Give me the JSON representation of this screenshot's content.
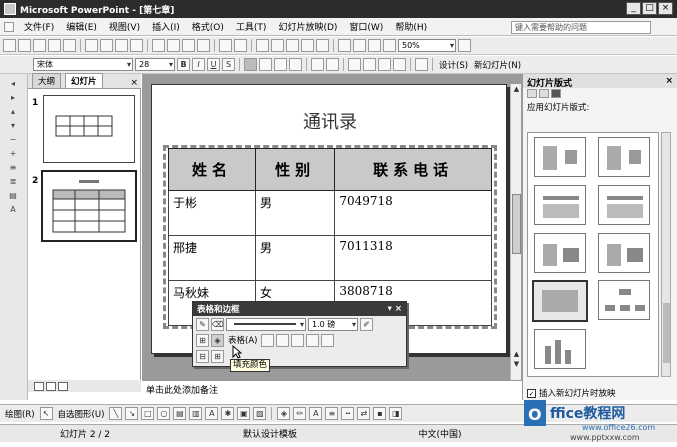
{
  "window": {
    "title": "Microsoft PowerPoint - [第七章]",
    "min": "_",
    "max": "□",
    "close": "×"
  },
  "menu": [
    "文件(F)",
    "编辑(E)",
    "视图(V)",
    "插入(I)",
    "格式(O)",
    "工具(T)",
    "幻灯片放映(D)",
    "窗口(W)",
    "帮助(H)"
  ],
  "help_placeholder": "键入需要帮助的问题",
  "toolbar1": {
    "zoom": "50%"
  },
  "toolbar2": {
    "font": "宋体",
    "size": "28",
    "bold": "B",
    "italic": "I",
    "underline": "U",
    "shadow": "S",
    "design": "设计(S)",
    "new_slide": "新幻灯片(N)"
  },
  "outline_tabs": {
    "outline": "大纲",
    "slides": "幻灯片",
    "close": "×"
  },
  "slides": [
    {
      "num": "1"
    },
    {
      "num": "2"
    }
  ],
  "slide": {
    "title": "通讯录",
    "headers": [
      "姓名",
      "性别",
      "联系电话"
    ],
    "rows": [
      [
        "于彬",
        "男",
        "7049718"
      ],
      [
        "邢捷",
        "男",
        "7011318"
      ],
      [
        "马秋妹",
        "女",
        "3808718"
      ]
    ]
  },
  "notes_placeholder": "单击此处添加备注",
  "taskpane": {
    "title": "幻灯片版式",
    "close": "×",
    "subtitle": "应用幻灯片版式:",
    "checkbox": "插入新幻灯片时放映"
  },
  "floatbar": {
    "title": "表格和边框",
    "line_weight": "1.0 磅",
    "table_menu": "表格(A)"
  },
  "tooltip": "填充颜色",
  "drawbar": {
    "draw": "绘图(R)",
    "autoshapes": "自选图形(U)"
  },
  "status": {
    "slide": "幻灯片 2 / 2",
    "template": "默认设计模板",
    "language": "中文(中国)"
  },
  "watermark": {
    "brand": "Office教程网",
    "url": "www.office26.com",
    "url2": "www.pptxxw.com"
  }
}
